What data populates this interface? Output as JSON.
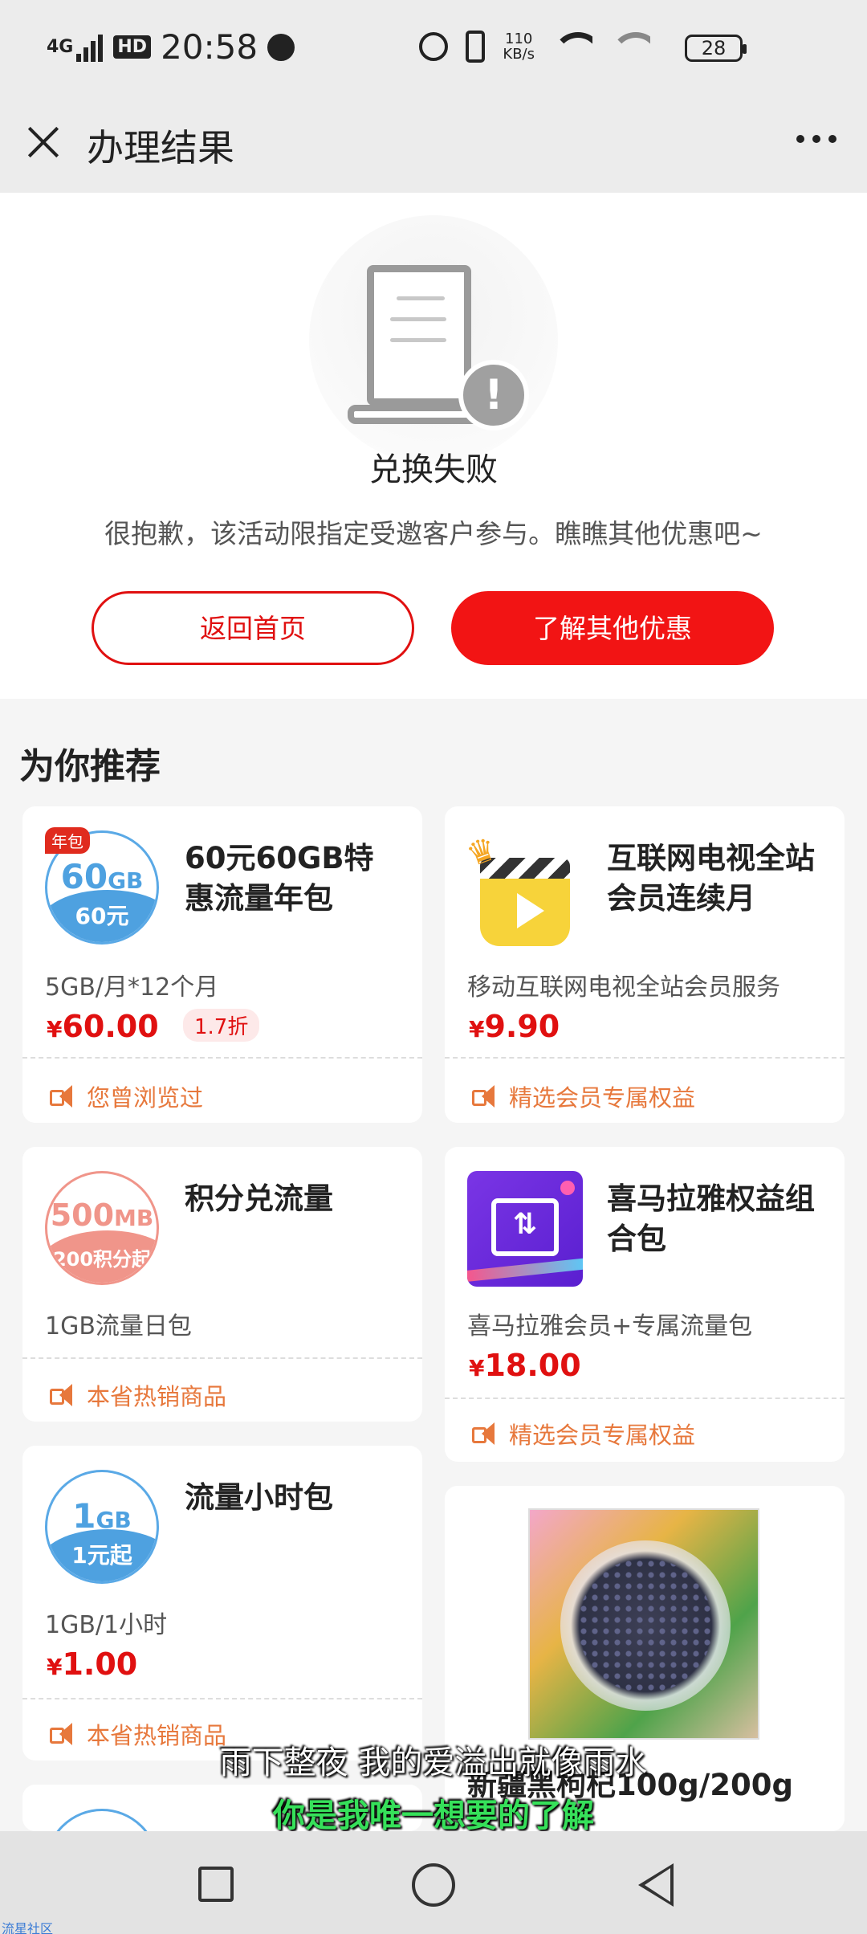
{
  "status_bar": {
    "network": "4G",
    "hd": "HD",
    "time": "20:58",
    "speed_value": "110",
    "speed_unit": "KB/s",
    "battery": "28"
  },
  "header": {
    "title": "办理结果"
  },
  "result": {
    "title": "兑换失败",
    "description": "很抱歉，该活动限指定受邀客户参与。瞧瞧其他优惠吧~",
    "button_home": "返回首页",
    "button_other": "了解其他优惠"
  },
  "recommend": {
    "title": "为你推荐",
    "cards": [
      {
        "badge": "年包",
        "thumb_top": "60",
        "thumb_top_unit": "GB",
        "thumb_bottom": "60元",
        "name": "60元60GB特惠流量年包",
        "desc": "5GB/月*12个月",
        "price": "60.00",
        "discount": "1.7折",
        "foot": "您曾浏览过"
      },
      {
        "name": "互联网电视全站会员连续月",
        "desc": "移动互联网电视全站会员服务",
        "price": "9.90",
        "foot": "精选会员专属权益",
        "icon": "tv-play-icon"
      },
      {
        "thumb_top": "500",
        "thumb_top_unit": "MB",
        "thumb_bottom": "200积分起",
        "name": "积分兑流量",
        "desc": "1GB流量日包",
        "foot": "本省热销商品"
      },
      {
        "name": "喜马拉雅权益组合包",
        "desc": "喜马拉雅会员+专属流量包",
        "price": "18.00",
        "foot": "精选会员专属权益",
        "icon": "ximalaya-icon"
      },
      {
        "thumb_top": "1",
        "thumb_top_unit": "GB",
        "thumb_bottom": "1元起",
        "name": "流量小时包",
        "desc": "1GB/1小时",
        "price": "1.00",
        "foot": "本省热销商品"
      },
      {
        "name": "新疆黑枸杞100g/200g",
        "image": "goji-photo"
      }
    ],
    "currency": "¥"
  },
  "subtitles": {
    "line1": "雨下整夜 我的爱溢出就像雨水",
    "line2": "你是我唯一想要的了解"
  },
  "watermark": "流星社区",
  "colors": {
    "accent": "#f21414",
    "price": "#e01010",
    "foot": "#e7783c",
    "background": "#f5f5f5"
  }
}
